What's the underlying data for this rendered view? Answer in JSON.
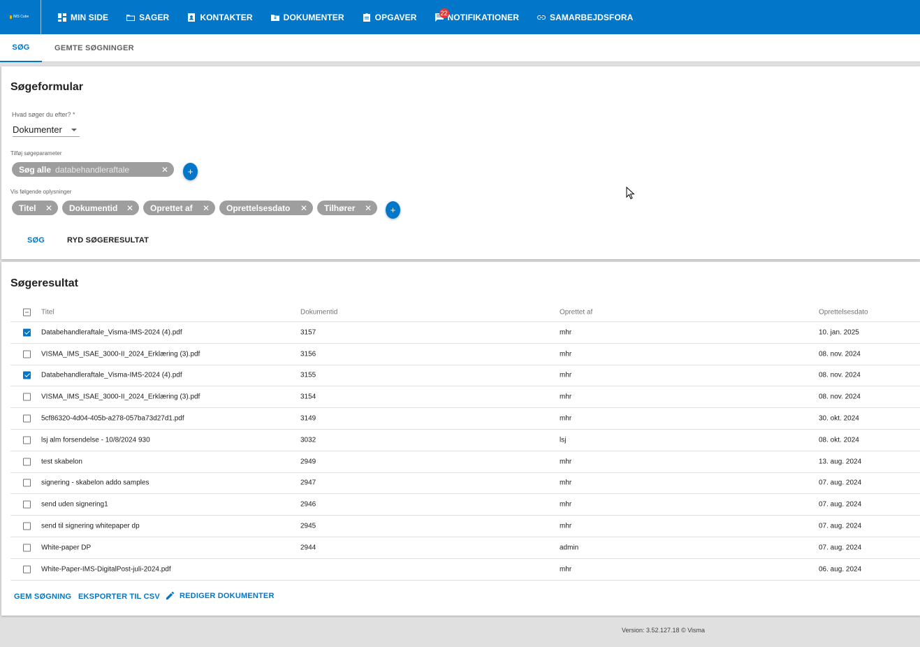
{
  "logo": {
    "text": "IMS Cube"
  },
  "nav": [
    {
      "label": "MIN SIDE",
      "icon": "dashboard-icon"
    },
    {
      "label": "SAGER",
      "icon": "folder-icon"
    },
    {
      "label": "KONTAKTER",
      "icon": "contact-icon"
    },
    {
      "label": "DOKUMENTER",
      "icon": "document-folder-icon"
    },
    {
      "label": "OPGAVER",
      "icon": "clipboard-icon"
    },
    {
      "label": "NOTIFIKATIONER",
      "icon": "notification-icon",
      "badge": "22"
    },
    {
      "label": "SAMARBEJDSFORA",
      "icon": "link-icon"
    }
  ],
  "tabs": [
    "SØG",
    "GEMTE SØGNINGER"
  ],
  "search_form": {
    "title": "Søgeformular",
    "what_label": "Hvad søger du efter? *",
    "what_value": "Dokumenter",
    "params_label": "Tilføj søgeparameter",
    "param_chip": {
      "label": "Søg alle",
      "value": "databehandleraftale"
    },
    "show_label": "Vis følgende oplysninger",
    "columns": [
      "Titel",
      "Dokumentid",
      "Oprettet af",
      "Oprettelsesdato",
      "Tilhører"
    ],
    "search_button": "SØG",
    "clear_button": "RYD SØGERESULTAT"
  },
  "results": {
    "title": "Søgeresultat",
    "headers": [
      "Titel",
      "Dokumentid",
      "Oprettet af",
      "Oprettelsesdato"
    ],
    "rows": [
      {
        "checked": true,
        "title": "Databehandleraftale_Visma-IMS-2024 (4).pdf",
        "id": "3157",
        "owner": "mhr",
        "date": "10. jan. 2025"
      },
      {
        "checked": false,
        "title": "VISMA_IMS_ISAE_3000-II_2024_Erklæring (3).pdf",
        "id": "3156",
        "owner": "mhr",
        "date": "08. nov. 2024"
      },
      {
        "checked": true,
        "title": "Databehandleraftale_Visma-IMS-2024 (4).pdf",
        "id": "3155",
        "owner": "mhr",
        "date": "08. nov. 2024"
      },
      {
        "checked": false,
        "title": "VISMA_IMS_ISAE_3000-II_2024_Erklæring (3).pdf",
        "id": "3154",
        "owner": "mhr",
        "date": "08. nov. 2024"
      },
      {
        "checked": false,
        "title": "5cf86320-4d04-405b-a278-057ba73d27d1.pdf",
        "id": "3149",
        "owner": "mhr",
        "date": "30. okt. 2024"
      },
      {
        "checked": false,
        "title": "lsj alm forsendelse - 10/8/2024 930",
        "id": "3032",
        "owner": "lsj",
        "date": "08. okt. 2024"
      },
      {
        "checked": false,
        "title": "test skabelon",
        "id": "2949",
        "owner": "mhr",
        "date": "13. aug. 2024"
      },
      {
        "checked": false,
        "title": "signering - skabelon addo samples",
        "id": "2947",
        "owner": "mhr",
        "date": "07. aug. 2024"
      },
      {
        "checked": false,
        "title": "send uden signering1",
        "id": "2946",
        "owner": "mhr",
        "date": "07. aug. 2024"
      },
      {
        "checked": false,
        "title": "send til signering whitepaper dp",
        "id": "2945",
        "owner": "mhr",
        "date": "07. aug. 2024"
      },
      {
        "checked": false,
        "title": "White-paper DP",
        "id": "2944",
        "owner": "admin",
        "date": "07. aug. 2024"
      },
      {
        "checked": false,
        "title": "White-Paper-IMS-DigitalPost-juli-2024.pdf",
        "id": "",
        "owner": "mhr",
        "date": "06. aug. 2024"
      }
    ],
    "actions": {
      "save": "GEM SØGNING",
      "export": "EKSPORTER TIL CSV",
      "edit": "REDIGER DOKUMENTER"
    }
  },
  "footer": "Version: 3.52.127.18   © Visma",
  "colors": {
    "primary": "#0277c9",
    "chip": "#9e9e9e",
    "background": "#e0e0e0"
  }
}
